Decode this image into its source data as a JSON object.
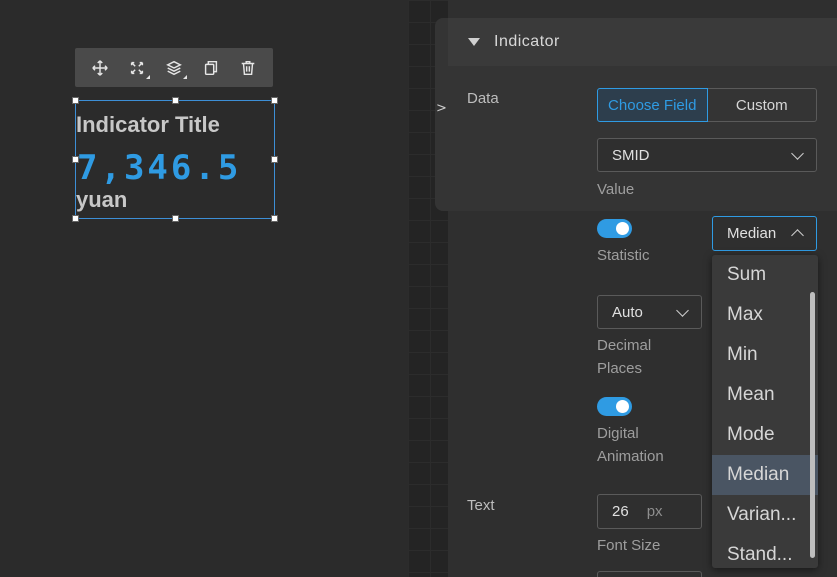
{
  "toolbar": {
    "icons": [
      "move-icon",
      "fullscreen-icon",
      "layers-icon",
      "copy-icon",
      "delete-icon"
    ]
  },
  "widget": {
    "title": "Indicator Title",
    "value": "7,346.5",
    "unit": "yuan"
  },
  "panel": {
    "collapse_arrow": ">",
    "section_title": "Indicator",
    "data_label": "Data",
    "source_tabs": {
      "choose_field": "Choose Field",
      "custom": "Custom",
      "active": "Choose Field"
    },
    "field_select": {
      "value": "SMID",
      "label": "Value"
    },
    "statistic": {
      "enabled": true,
      "label": "Statistic",
      "value": "Median"
    },
    "decimal": {
      "value": "Auto",
      "label_line1": "Decimal",
      "label_line2": "Places"
    },
    "animation": {
      "enabled": true,
      "label_line1": "Digital",
      "label_line2": "Animation"
    },
    "text_label": "Text",
    "font_size": {
      "value": "26",
      "unit": "px",
      "label": "Font Size"
    }
  },
  "statistic_dropdown": {
    "options": [
      "Sum",
      "Max",
      "Min",
      "Mean",
      "Mode",
      "Median",
      "Varian...",
      "Stand..."
    ],
    "selected": "Median"
  },
  "colors": {
    "accent": "#2f9be3",
    "background": "#2b2b2b",
    "panel": "#2f2f2f"
  }
}
